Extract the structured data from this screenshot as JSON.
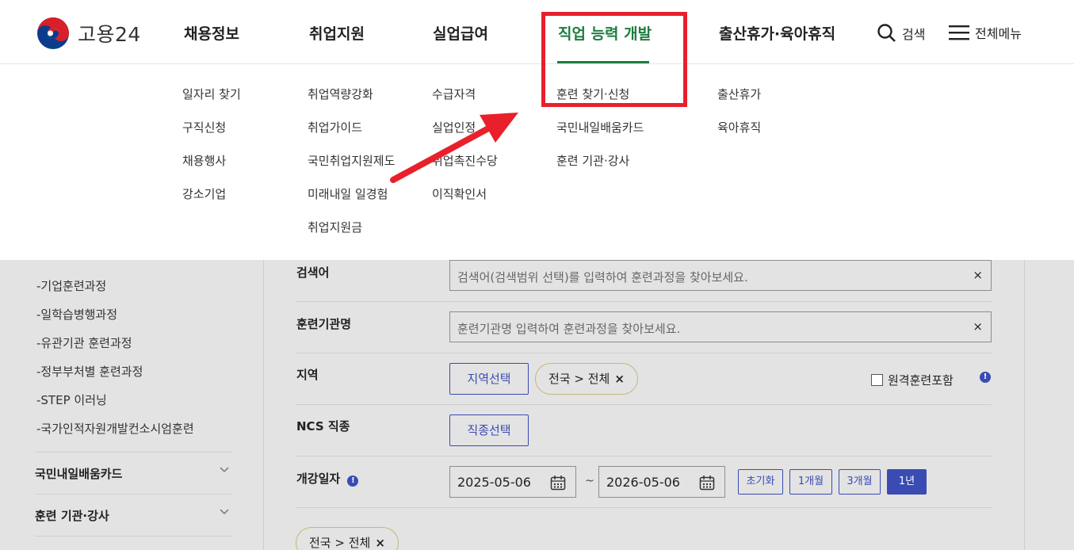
{
  "header": {
    "logo_text": "고용24",
    "nav": [
      {
        "label": "채용정보"
      },
      {
        "label": "취업지원"
      },
      {
        "label": "실업급여"
      },
      {
        "label": "직업 능력 개발",
        "active": true
      },
      {
        "label": "출산휴가·육아휴직"
      }
    ],
    "search_label": "검색",
    "menu_label": "전체메뉴",
    "active_color": "#1e7d3f"
  },
  "mega_menu": {
    "columns": [
      [
        "일자리 찾기",
        "구직신청",
        "채용행사",
        "강소기업"
      ],
      [
        "취업역량강화",
        "취업가이드",
        "국민취업지원제도",
        "미래내일 일경험",
        "취업지원금"
      ],
      [
        "수급자격",
        "실업인정",
        "취업촉진수당",
        "이직확인서"
      ],
      [
        "훈련 찾기·신청",
        "국민내일배움카드",
        "훈련 기관·강사"
      ],
      [
        "출산휴가",
        "육아휴직"
      ]
    ]
  },
  "sidebar": {
    "sub_items": [
      "-기업훈련과정",
      "-일학습병행과정",
      "-유관기관 훈련과정",
      "-정부부처별 훈련과정",
      "-STEP 이러닝",
      "-국가인적자원개발컨소시엄훈련"
    ],
    "sections": [
      "국민내일배움카드",
      "훈련 기관·강사"
    ]
  },
  "search_form": {
    "keyword": {
      "label": "검색어",
      "placeholder": "검색어(검색범위 선택)를 입력하여 훈련과정을 찾아보세요."
    },
    "institution": {
      "label": "훈련기관명",
      "placeholder": "훈련기관명 입력하여 훈련과정을 찾아보세요."
    },
    "region": {
      "label": "지역",
      "button": "지역선택",
      "chip": "전국 > 전체",
      "remote_label": "원격훈련포함"
    },
    "ncs": {
      "label": "NCS 직종",
      "button": "직종선택"
    },
    "date": {
      "label": "개강일자",
      "start": "2025-05-06",
      "tilde": "~",
      "end": "2026-05-06",
      "periods": [
        "초기화",
        "1개월",
        "3개월",
        "1년"
      ],
      "selected_period": "1년"
    },
    "selected_chip": "전국 > 전체",
    "clear_symbol": "×",
    "chip_remove_symbol": "×",
    "info_symbol": "!"
  },
  "annotation": {
    "color": "#e8202b"
  }
}
